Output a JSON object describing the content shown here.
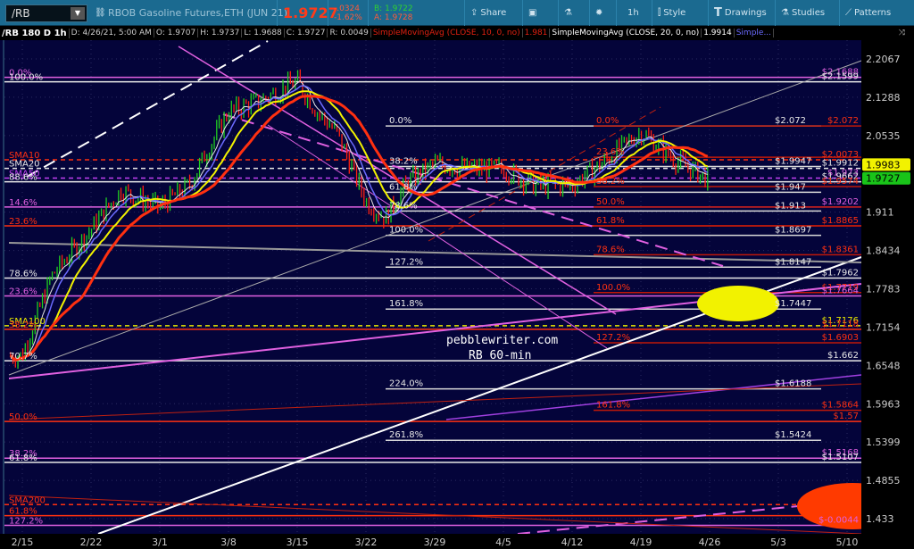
{
  "toolbar": {
    "symbol": "/RB",
    "description": "RBOB Gasoline Futures,ETH (JUN 21)",
    "last": "1.9727",
    "change": "-.0324",
    "change_pct": "-1.62%",
    "bid": "B: 1.9722",
    "ask": "A: 1.9728",
    "share": "Share",
    "timeframe": "1h",
    "style": "Style",
    "drawings": "Drawings",
    "studies": "Studies",
    "patterns": "Patterns"
  },
  "infobar": {
    "title": "/RB 180 D 1h",
    "date": "D: 4/26/21, 5:00 AM",
    "open": "O: 1.9707",
    "high": "H: 1.9737",
    "low": "L: 1.9688",
    "close": "C: 1.9727",
    "range": "R: 0.0049",
    "sma10": "SimpleMovingAvg (CLOSE, 10, 0, no)",
    "sma10_val": "1.981",
    "sma20": "SimpleMovingAvg (CLOSE, 20, 0, no)",
    "sma20_val": "1.9914",
    "more": "Simple..."
  },
  "chart_data": {
    "type": "line",
    "title": "/RB 180 D 1h",
    "scale": "log",
    "ylim": [
      1.42,
      2.24
    ],
    "x_ticks": [
      "2/15",
      "2/22",
      "3/1",
      "3/8",
      "3/15",
      "3/22",
      "3/29",
      "4/5",
      "4/12",
      "4/19",
      "4/26",
      "5/3",
      "5/10"
    ],
    "y_ticks": [
      "2.2067",
      "2.1288",
      "2.0535",
      "1.911",
      "1.8434",
      "1.7783",
      "1.7154",
      "1.6548",
      "1.5963",
      "1.5399",
      "1.4855",
      "1.433"
    ],
    "price_badges": [
      {
        "value": "1.9983",
        "color": "#f2f200"
      },
      {
        "value": "1.9727",
        "color": "#19c419"
      }
    ],
    "series_closes_by_day": {
      "days": [
        0,
        3,
        7,
        10,
        14,
        17,
        21,
        24,
        28,
        30,
        32,
        35,
        37,
        39,
        42,
        45,
        49,
        52,
        56,
        59,
        63,
        65,
        67,
        70
      ],
      "values": [
        1.67,
        1.8,
        1.88,
        1.95,
        1.92,
        1.96,
        2.1,
        2.12,
        2.16,
        2.1,
        2.06,
        1.93,
        1.9,
        1.96,
        2.0,
        1.99,
        1.99,
        1.96,
        1.96,
        2.0,
        2.06,
        2.03,
        2.0,
        1.97
      ]
    },
    "left_fibs": [
      {
        "label": "0.0%",
        "price": 2.1688,
        "color": "#e060e0"
      },
      {
        "label": "100.0%",
        "price": 2.1599,
        "color": "#e8e8e8"
      },
      {
        "label": "SMA10",
        "price": 2.0073,
        "color": "#ff3010",
        "dash": true
      },
      {
        "label": "SMA20",
        "price": 1.9912,
        "color": "#e8e8e8",
        "dash": true
      },
      {
        "label": "SMA50",
        "price": 1.973,
        "color": "#c040f0",
        "dash": true
      },
      {
        "label": "88.6%",
        "price": 1.9662,
        "color": "#e8e8e8"
      },
      {
        "label": "14.6%",
        "price": 1.9202,
        "color": "#e060e0"
      },
      {
        "label": "23.6%",
        "price": 1.8865,
        "color": "#ff3010"
      },
      {
        "label": "78.6%",
        "price": 1.7962,
        "color": "#e8e8e8"
      },
      {
        "label": "23.6%",
        "price": 1.7664,
        "color": "#e060e0"
      },
      {
        "label": "SMA100",
        "price": 1.7176,
        "color": "#e8e800",
        "dash": true
      },
      {
        "label": "38.2%",
        "price": 1.7118,
        "color": "#ff3010"
      },
      {
        "label": "70.7%",
        "price": 1.662,
        "color": "#e8e8e8"
      },
      {
        "label": "50.0%",
        "price": 1.57,
        "color": "#ff3010"
      },
      {
        "label": "38.2%",
        "price": 1.5168,
        "color": "#e060e0"
      },
      {
        "label": "61.8%",
        "price": 1.5107,
        "color": "#e8e8e8"
      },
      {
        "label": "SMA200",
        "price": 1.452,
        "color": "#ff3010",
        "dash": true
      },
      {
        "label": "61.8%",
        "price": 1.437,
        "color": "#ff3010"
      },
      {
        "label": "127.2%",
        "price": 1.424,
        "color": "#e060e0"
      }
    ],
    "mid_fibs": [
      {
        "label": "0.0%",
        "price": 2.072,
        "value": "$2.072"
      },
      {
        "label": "38.2%",
        "price": 1.9947,
        "value": "$1.9947"
      },
      {
        "label": "61.8%",
        "price": 1.947,
        "value": "$1.947"
      },
      {
        "label": "78.6%",
        "price": 1.913,
        "value": "$1.913"
      },
      {
        "label": "100.0%",
        "price": 1.8697,
        "value": "$1.8697"
      },
      {
        "label": "127.2%",
        "price": 1.8147,
        "value": "$1.8147"
      },
      {
        "label": "161.8%",
        "price": 1.7447,
        "value": "$1.7447"
      },
      {
        "label": "224.0%",
        "price": 1.6188,
        "value": "$1.6188"
      },
      {
        "label": "261.8%",
        "price": 1.5424,
        "value": "$1.5424"
      }
    ],
    "red_fibs": [
      {
        "label": "0.0%",
        "price": 2.072
      },
      {
        "label": "23.6%",
        "price": 2.012
      },
      {
        "label": "38.2%",
        "price": 1.9574
      },
      {
        "label": "50.0%",
        "price": 1.9202
      },
      {
        "label": "61.8%",
        "price": 1.8865
      },
      {
        "label": "78.6%",
        "price": 1.8361
      },
      {
        "label": "100.0%",
        "price": 1.7719
      },
      {
        "label": "127.2%",
        "price": 1.6903
      },
      {
        "label": "161.8%",
        "price": 1.5864
      }
    ],
    "right_values": [
      {
        "value": "$2.1688",
        "price": 2.1688,
        "color": "#e060e0"
      },
      {
        "value": "$2.1599",
        "price": 2.1599,
        "color": "#e8e8e8"
      },
      {
        "value": "$2.072",
        "price": 2.072,
        "color": "#ff3010"
      },
      {
        "value": "$2.0073",
        "price": 2.0073,
        "color": "#ff3010"
      },
      {
        "value": "$1.9912",
        "price": 1.9912,
        "color": "#e8e8e8"
      },
      {
        "value": "$1.973",
        "price": 1.973,
        "color": "#e060e0"
      },
      {
        "value": "$1.9662",
        "price": 1.9662,
        "color": "#e8e8e8"
      },
      {
        "value": "$1.9574",
        "price": 1.9574,
        "color": "#ff3010"
      },
      {
        "value": "$1.9202",
        "price": 1.9202,
        "color": "#e060e0"
      },
      {
        "value": "$1.8865",
        "price": 1.8865,
        "color": "#ff3010"
      },
      {
        "value": "$1.8361",
        "price": 1.8361,
        "color": "#ff3010"
      },
      {
        "value": "$1.7962",
        "price": 1.7962,
        "color": "#e8e8e8"
      },
      {
        "value": "$1.7719",
        "price": 1.7719,
        "color": "#ff3010"
      },
      {
        "value": "$1.7664",
        "price": 1.7664,
        "color": "#e060e0"
      },
      {
        "value": "$1.7176",
        "price": 1.7176,
        "color": "#e8e800"
      },
      {
        "value": "$1.7118",
        "price": 1.7118,
        "color": "#ff3010"
      },
      {
        "value": "$1.6903",
        "price": 1.6903,
        "color": "#ff3010"
      },
      {
        "value": "$1.662",
        "price": 1.662,
        "color": "#e8e8e8"
      },
      {
        "value": "$1.5864",
        "price": 1.5864,
        "color": "#ff3010"
      },
      {
        "value": "$1.57",
        "price": 1.57,
        "color": "#ff3010"
      },
      {
        "value": "$1.5168",
        "price": 1.5168,
        "color": "#e060e0"
      },
      {
        "value": "$1.5107",
        "price": 1.5107,
        "color": "#e8e8e8"
      },
      {
        "value": "$-0.0044",
        "price": 1.424,
        "color": "#e060e0"
      }
    ],
    "annotations": [
      "pebblewriter.com",
      "RB 60-min"
    ]
  },
  "colors": {
    "bg": "#04043a",
    "toolbar": "#1b6a90",
    "sma10": "#ff3010",
    "sma20": "#e8e8e8",
    "sma50": "#6c6cff",
    "sma100": "#f2f200"
  }
}
